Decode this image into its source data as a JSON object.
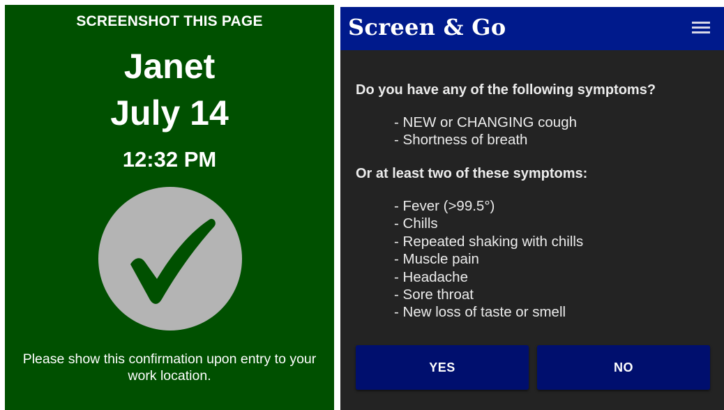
{
  "confirmation": {
    "instruction": "SCREENSHOT THIS PAGE",
    "name": "Janet",
    "date": "July 14",
    "time": "12:32 PM",
    "status_icon": "checkmark-icon",
    "message": "Please show this confirmation upon entry to your work location.",
    "colors": {
      "background": "#005000",
      "circle": "#b4b4b4",
      "check": "#005000"
    }
  },
  "app": {
    "title": "Screen & Go",
    "menu_icon": "hamburger-menu-icon",
    "colors": {
      "header": "#001a8c",
      "background": "#232323",
      "button": "#000f6e"
    }
  },
  "question": {
    "prompt": "Do you have any of the following symptoms?",
    "primary_symptoms": [
      "- NEW or CHANGING cough",
      "- Shortness of breath"
    ],
    "secondary_prompt": "Or at least two of these symptoms:",
    "secondary_symptoms": [
      "- Fever (>99.5°)",
      "- Chills",
      "- Repeated shaking with chills",
      "- Muscle pain",
      "- Headache",
      "- Sore throat",
      "- New loss of taste or smell"
    ]
  },
  "actions": {
    "yes_label": "YES",
    "no_label": "NO"
  }
}
